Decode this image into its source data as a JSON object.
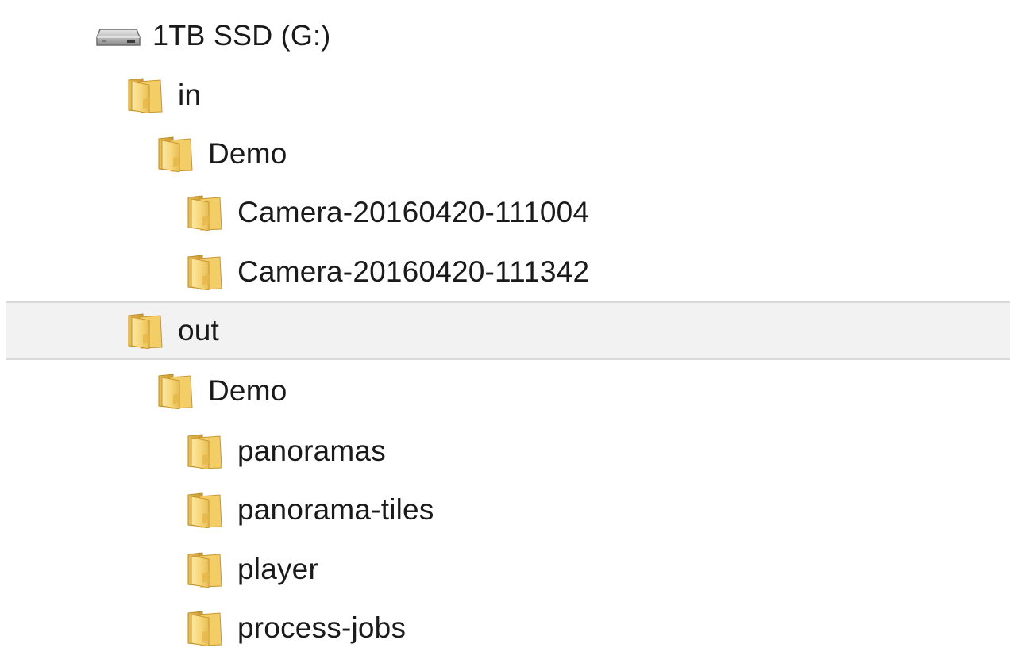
{
  "tree": {
    "drive": {
      "label": "1TB SSD (G:)",
      "icon": "drive-icon"
    },
    "items": [
      {
        "label": "in",
        "icon": "folder-icon",
        "level": 1
      },
      {
        "label": "Demo",
        "icon": "folder-icon",
        "level": 2
      },
      {
        "label": "Camera-20160420-111004",
        "icon": "folder-icon",
        "level": 3
      },
      {
        "label": "Camera-20160420-111342",
        "icon": "folder-icon",
        "level": 3
      },
      {
        "label": "out",
        "icon": "folder-icon",
        "level": 1,
        "selected": true
      },
      {
        "label": "Demo",
        "icon": "folder-icon",
        "level": 2
      },
      {
        "label": "panoramas",
        "icon": "folder-icon",
        "level": 3
      },
      {
        "label": "panorama-tiles",
        "icon": "folder-icon",
        "level": 3
      },
      {
        "label": "player",
        "icon": "folder-icon",
        "level": 3
      },
      {
        "label": "process-jobs",
        "icon": "folder-icon",
        "level": 3
      }
    ]
  },
  "colors": {
    "folder_front": "#f6d77a",
    "folder_back": "#e3b94a",
    "folder_edge": "#c9962e",
    "selection_bg": "#f2f2f2",
    "selection_border": "#d9d9d9"
  }
}
